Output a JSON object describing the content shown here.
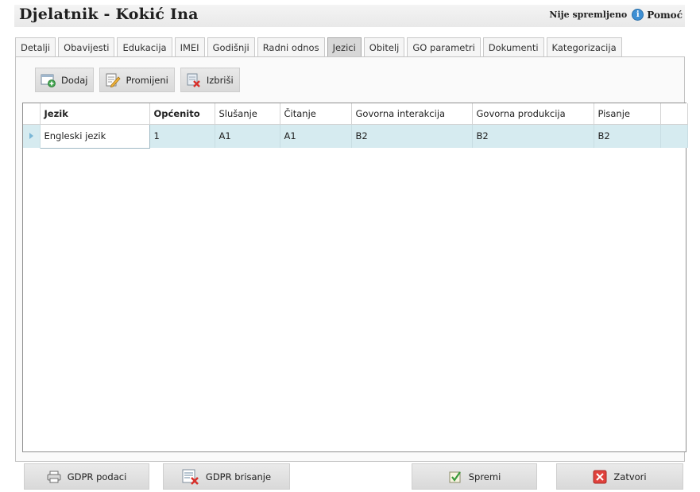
{
  "header": {
    "title": "Djelatnik - Kokić Ina",
    "status": "Nije spremljeno",
    "help_label": "Pomoć"
  },
  "tabs": [
    {
      "label": "Detalji"
    },
    {
      "label": "Obavijesti"
    },
    {
      "label": "Edukacija"
    },
    {
      "label": "IMEI"
    },
    {
      "label": "Godišnji"
    },
    {
      "label": "Radni odnos"
    },
    {
      "label": "Jezici",
      "active": true
    },
    {
      "label": "Obitelj"
    },
    {
      "label": "GO parametri"
    },
    {
      "label": "Dokumenti"
    },
    {
      "label": "Kategorizacija"
    }
  ],
  "toolbar": {
    "add_label": "Dodaj",
    "edit_label": "Promijeni",
    "delete_label": "Izbriši"
  },
  "grid": {
    "columns": [
      "Jezik",
      "Općenito",
      "Slušanje",
      "Čitanje",
      "Govorna interakcija",
      "Govorna produkcija",
      "Pisanje"
    ],
    "rows": [
      [
        "Engleski jezik",
        "1",
        "A1",
        "A1",
        "B2",
        "B2",
        "B2"
      ]
    ]
  },
  "footer": {
    "gdpr_data_label": "GDPR podaci",
    "gdpr_delete_label": "GDPR brisanje",
    "save_label": "Spremi",
    "close_label": "Zatvori"
  },
  "colors": {
    "selected_row": "#d6ebf0",
    "active_tab": "#d7d7d7",
    "info_icon": "#3d8fd4",
    "close_icon": "#e0413c"
  }
}
